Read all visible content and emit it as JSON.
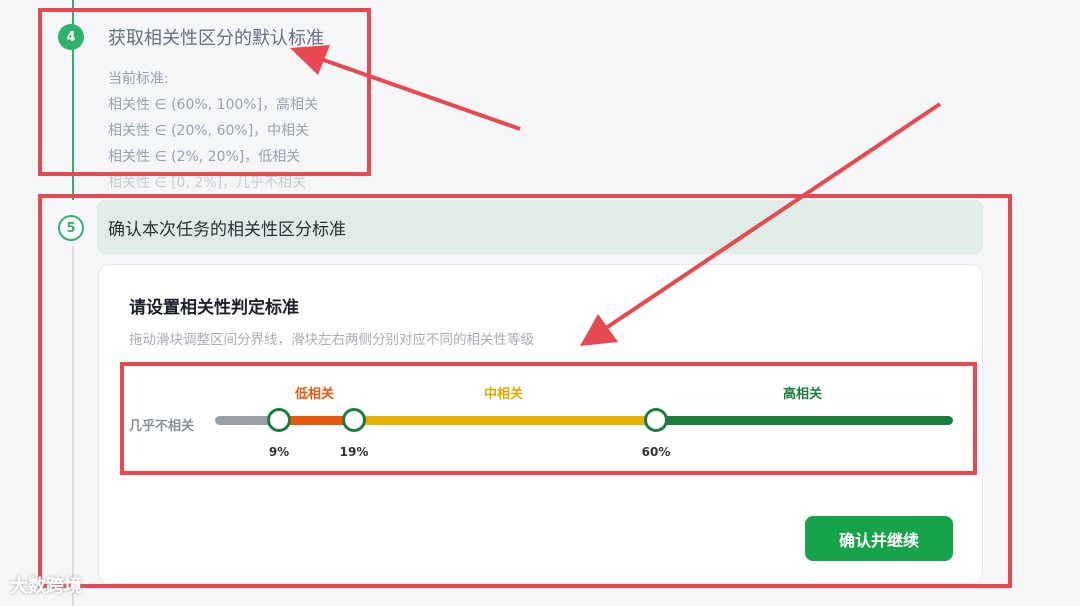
{
  "step4": {
    "number": "4",
    "title": "获取相关性区分的默认标准",
    "standard_label": "当前标准:",
    "standards": [
      "相关性 ∈ (60%, 100%]，高相关",
      "相关性 ∈ (20%, 60%]，中相关",
      "相关性 ∈ (2%, 20%]，低相关",
      "相关性 ∈ [0, 2%]，几乎不相关"
    ]
  },
  "step5": {
    "number": "5",
    "title": "确认本次任务的相关性区分标准"
  },
  "card": {
    "title": "请设置相关性判定标准",
    "description": "拖动滑块调整区间分界线，滑块左右两侧分别对应不同的相关性等级"
  },
  "slider": {
    "none_label": "几乎不相关",
    "zones": {
      "low": "低相关",
      "mid": "中相关",
      "high": "高相关"
    },
    "thresholds": [
      "9%",
      "19%",
      "60%"
    ],
    "colors": {
      "none": "#9aa0a8",
      "low": "#e8590c",
      "mid": "#e6b000",
      "high": "#1a7f3c"
    }
  },
  "confirm_button": "确认并继续",
  "watermark": "大数跨境",
  "colors": {
    "accent": "#16a34a",
    "annotation": "#e8484f"
  }
}
